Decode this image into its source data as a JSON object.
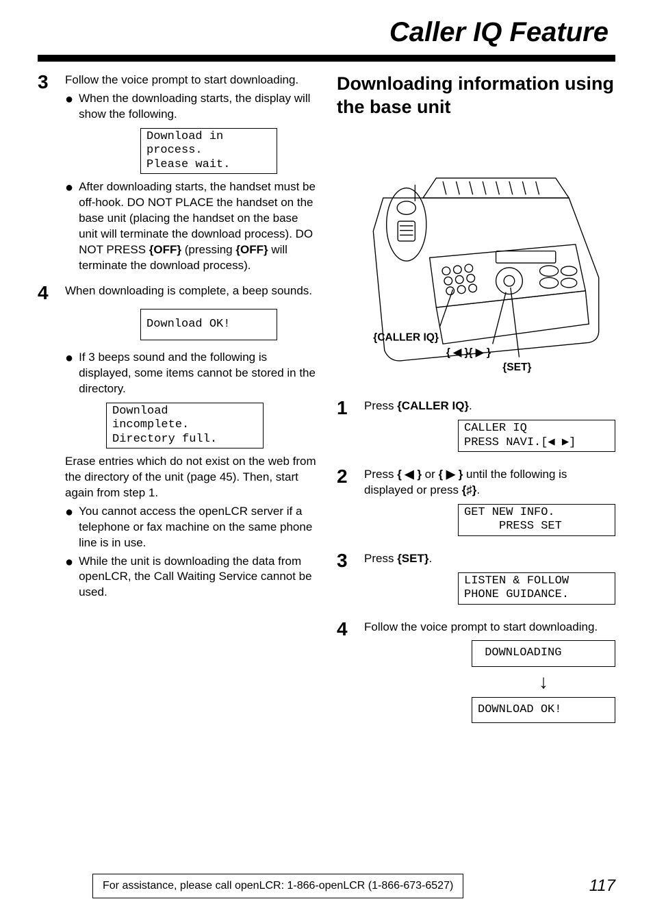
{
  "header": {
    "title": "Caller IQ Feature"
  },
  "left": {
    "step3": {
      "num": "3",
      "text": "Follow the voice prompt to start downloading.",
      "bullet1": "When the downloading starts, the display will show the following.",
      "lcd1": "Download in\nprocess.\nPlease wait.",
      "bullet2_pre": "After downloading starts, the handset must be off-hook. DO NOT PLACE the handset on the base unit (placing the handset on the base unit will terminate the download process). DO NOT PRESS ",
      "bullet2_key1": "{OFF}",
      "bullet2_mid": " (pressing ",
      "bullet2_key2": "{OFF}",
      "bullet2_post": " will terminate the download process)."
    },
    "step4": {
      "num": "4",
      "text": "When downloading is complete, a beep sounds.",
      "lcd1": "Download OK!",
      "bullet1": "If 3 beeps sound and the following is displayed, some items cannot be stored in the directory.",
      "lcd2": "Download\nincomplete.\nDirectory full.",
      "para1": "Erase entries which do not exist on the web from the directory of the unit (page 45). Then, start again from step 1.",
      "bullet2": "You cannot access the openLCR server if a telephone or fax machine on the same phone line is in use.",
      "bullet3": "While the unit is downloading the data from openLCR, the Call Waiting Service cannot be used."
    }
  },
  "right": {
    "section_title": "Downloading information using the base unit",
    "device_labels": {
      "caller_iq": "{CALLER IQ}",
      "nav": "{ ◀ }{ ▶ }",
      "set": "{SET}"
    },
    "step1": {
      "num": "1",
      "text_pre": "Press ",
      "key": "{CALLER IQ}",
      "text_post": ".",
      "lcd": "CALLER IQ\nPRESS NAVI.[◀ ▶]"
    },
    "step2": {
      "num": "2",
      "text_pre": "Press ",
      "key1": "{ ◀ }",
      "mid1": " or ",
      "key2": "{ ▶ }",
      "mid2": " until the following is displayed or press ",
      "key3": "{♯}",
      "text_post": ".",
      "lcd": "GET NEW INFO.\n     PRESS SET"
    },
    "step3": {
      "num": "3",
      "text_pre": "Press ",
      "key": "{SET}",
      "text_post": ".",
      "lcd": "LISTEN & FOLLOW\nPHONE GUIDANCE."
    },
    "step4": {
      "num": "4",
      "text": "Follow the voice prompt to start downloading.",
      "lcd1": " DOWNLOADING",
      "lcd2": "DOWNLOAD OK!"
    }
  },
  "footer": {
    "text": "For assistance, please call openLCR: 1-866-openLCR (1-866-673-6527)",
    "page": "117"
  }
}
